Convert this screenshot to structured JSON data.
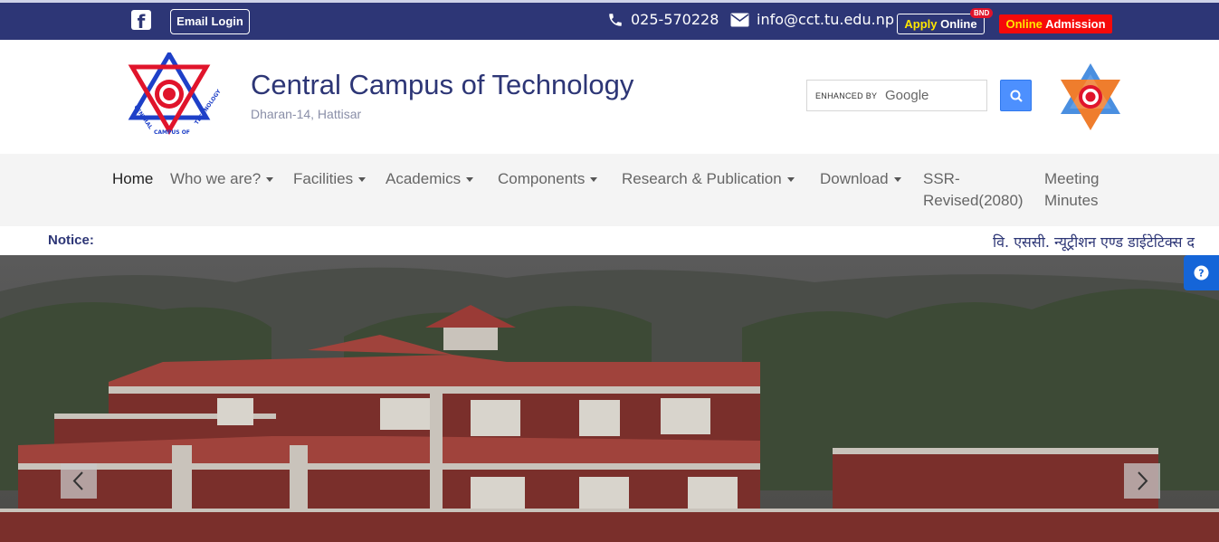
{
  "topbar": {
    "facebook_icon": "facebook-icon",
    "email_login_label": "Email Login",
    "phone": "025-570228",
    "email": "info@cct.tu.edu.np",
    "apply_word1": "Apply",
    "apply_word2": "Online",
    "badge": "BND",
    "admission_word1": "Online",
    "admission_word2": "Admission"
  },
  "header": {
    "title": "Central Campus of Technology",
    "subtitle": "Dharan-14, Hattisar",
    "logo_text": "CENTRAL CAMPUS OF TECHNOLOGY"
  },
  "search": {
    "enhanced_by": "ENHANCED BY",
    "brand": "Google"
  },
  "nav": {
    "items": [
      {
        "label": "Home"
      },
      {
        "label": "Who we are?"
      },
      {
        "label": "Facilities"
      },
      {
        "label": "Academics"
      },
      {
        "label": "Components"
      },
      {
        "label": "Research & Publication"
      },
      {
        "label": "Download"
      },
      {
        "label": "SSR-"
      },
      {
        "label": "Revised(2080)"
      },
      {
        "label": "Meeting"
      },
      {
        "label": "Minutes"
      }
    ]
  },
  "notice": {
    "label": "Notice:",
    "text": "वि. एससी. न्यूट्रीशन एण्ड डाईटेटिक्स द"
  },
  "colors": {
    "navy": "#2d3676",
    "admission_red": "#f50a0a",
    "search_blue": "#4d90fe",
    "help_blue": "#1565d8"
  }
}
